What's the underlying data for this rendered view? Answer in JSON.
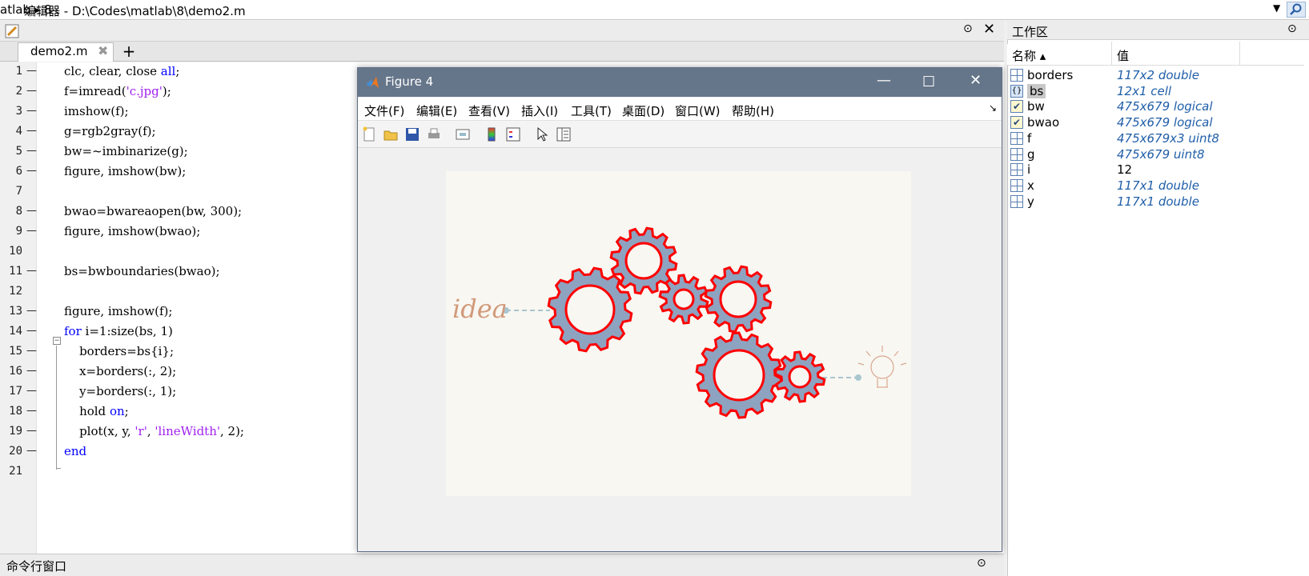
{
  "address_bar": {
    "path": "atlab ▸ 8"
  },
  "editor": {
    "title": "编辑器 - D:\\Codes\\matlab\\8\\demo2.m",
    "tab_label": "demo2.m",
    "lines": [
      {
        "n": "1",
        "dash": "—",
        "segs": [
          [
            "clc, clear, close ",
            ""
          ],
          [
            "all",
            "kw"
          ],
          [
            ";",
            ""
          ]
        ]
      },
      {
        "n": "2",
        "dash": "—",
        "segs": [
          [
            "f=imread(",
            ""
          ],
          [
            "'c.jpg'",
            "str"
          ],
          [
            ");",
            ""
          ]
        ]
      },
      {
        "n": "3",
        "dash": "—",
        "segs": [
          [
            "imshow(f);",
            ""
          ]
        ]
      },
      {
        "n": "4",
        "dash": "—",
        "segs": [
          [
            "g=rgb2gray(f);",
            ""
          ]
        ]
      },
      {
        "n": "5",
        "dash": "—",
        "segs": [
          [
            "bw=~imbinarize(g);",
            ""
          ]
        ]
      },
      {
        "n": "6",
        "dash": "—",
        "segs": [
          [
            "figure, imshow(bw);",
            ""
          ]
        ]
      },
      {
        "n": "7",
        "dash": "",
        "segs": []
      },
      {
        "n": "8",
        "dash": "—",
        "segs": [
          [
            "bwao=bwareaopen(bw, 300);",
            ""
          ]
        ]
      },
      {
        "n": "9",
        "dash": "—",
        "segs": [
          [
            "figure, imshow(bwao);",
            ""
          ]
        ]
      },
      {
        "n": "10",
        "dash": "",
        "segs": []
      },
      {
        "n": "11",
        "dash": "—",
        "segs": [
          [
            "bs=bwboundaries(bwao);",
            ""
          ]
        ]
      },
      {
        "n": "12",
        "dash": "",
        "segs": []
      },
      {
        "n": "13",
        "dash": "—",
        "segs": [
          [
            "figure, imshow(f);",
            ""
          ]
        ]
      },
      {
        "n": "14",
        "dash": "—",
        "segs": [
          [
            "for",
            "kw"
          ],
          [
            " i=1:size(bs, 1)",
            ""
          ]
        ]
      },
      {
        "n": "15",
        "dash": "—",
        "segs": [
          [
            "    borders=bs{i};",
            ""
          ]
        ]
      },
      {
        "n": "16",
        "dash": "—",
        "segs": [
          [
            "    x=borders(:, 2);",
            ""
          ]
        ]
      },
      {
        "n": "17",
        "dash": "—",
        "segs": [
          [
            "    y=borders(:, 1);",
            ""
          ]
        ]
      },
      {
        "n": "18",
        "dash": "—",
        "segs": [
          [
            "    hold ",
            ""
          ],
          [
            "on",
            "kw"
          ],
          [
            ";",
            ""
          ]
        ]
      },
      {
        "n": "19",
        "dash": "—",
        "segs": [
          [
            "    plot(x, y, ",
            ""
          ],
          [
            "'r'",
            "str"
          ],
          [
            ", ",
            ""
          ],
          [
            "'lineWidth'",
            "str"
          ],
          [
            ", 2);",
            ""
          ]
        ]
      },
      {
        "n": "20",
        "dash": "—",
        "segs": [
          [
            "end",
            "kw"
          ]
        ]
      },
      {
        "n": "21",
        "dash": "",
        "segs": []
      }
    ]
  },
  "command_window": {
    "title": "命令行窗口"
  },
  "workspace": {
    "title": "工作区",
    "col_name": "名称 ▴",
    "col_value": "值",
    "vars": [
      {
        "name": "borders",
        "value": "117x2 double",
        "numeric": false,
        "icon": "matrix-icon"
      },
      {
        "name": "bs",
        "value": "12x1 cell",
        "numeric": false,
        "icon": "cell-icon"
      },
      {
        "name": "bw",
        "value": "475x679 logical",
        "numeric": false,
        "icon": "logical-icon"
      },
      {
        "name": "bwao",
        "value": "475x679 logical",
        "numeric": false,
        "icon": "logical-icon"
      },
      {
        "name": "f",
        "value": "475x679x3 uint8",
        "numeric": false,
        "icon": "matrix-icon"
      },
      {
        "name": "g",
        "value": "475x679 uint8",
        "numeric": false,
        "icon": "matrix-icon"
      },
      {
        "name": "i",
        "value": "12",
        "numeric": true,
        "icon": "matrix-icon"
      },
      {
        "name": "x",
        "value": "117x1 double",
        "numeric": false,
        "icon": "matrix-icon"
      },
      {
        "name": "y",
        "value": "117x1 double",
        "numeric": false,
        "icon": "matrix-icon"
      }
    ]
  },
  "figure": {
    "title": "Figure 4",
    "menus": [
      "文件(F)",
      "编辑(E)",
      "查看(V)",
      "插入(I)",
      "工具(T)",
      "桌面(D)",
      "窗口(W)",
      "帮助(H)"
    ],
    "image_text": "idea",
    "colors": {
      "gear_fill": "#8ea3c0",
      "gear_outline": "#ff0000",
      "titlebar": "#66768a"
    }
  }
}
